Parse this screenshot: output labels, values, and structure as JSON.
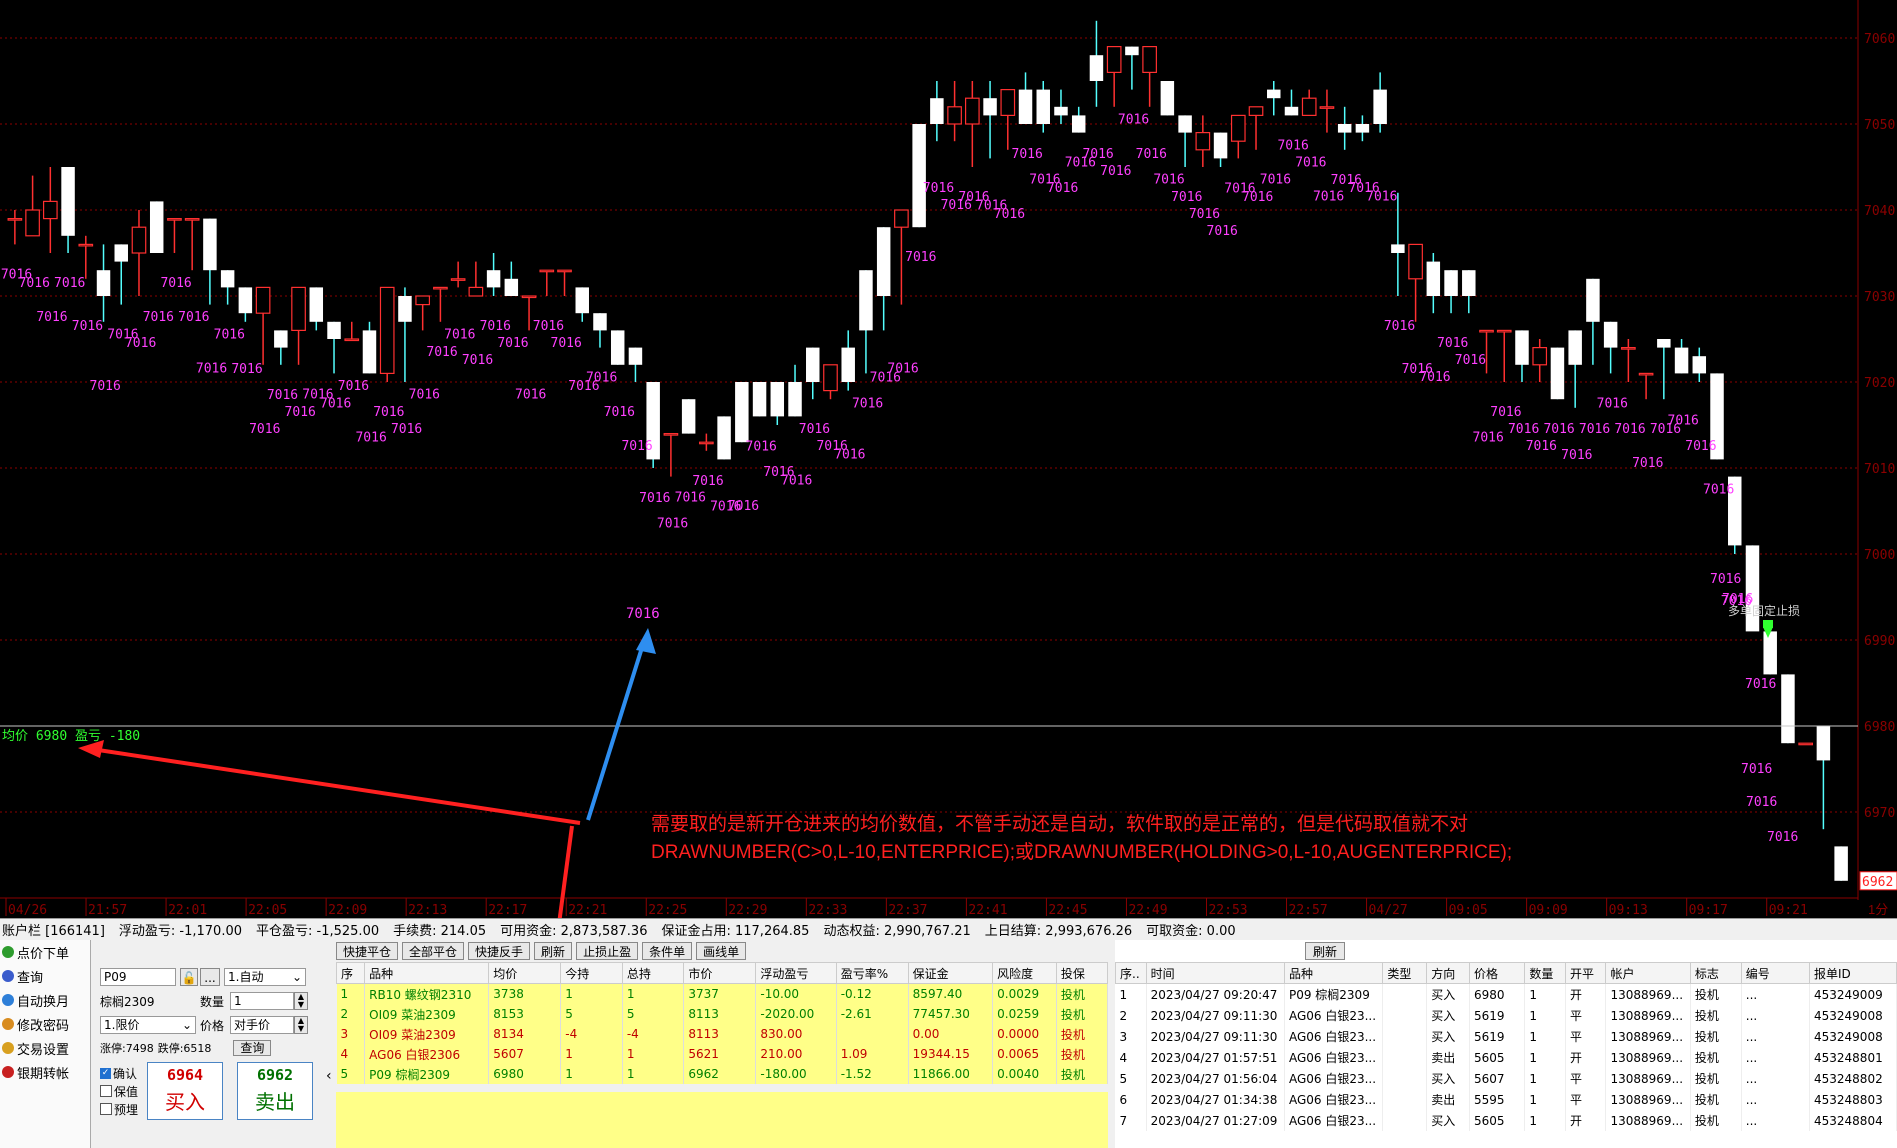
{
  "chart_data": {
    "type": "candlestick",
    "price_axis": {
      "min": 6962,
      "max": 7060,
      "ticks": [
        "7060",
        "7050",
        "7040",
        "7030",
        "7020",
        "7010",
        "7000",
        "6990",
        "6980",
        "6970"
      ],
      "current_price": "6962"
    },
    "time_axis": {
      "labels": [
        "04/26",
        "21:57",
        "22:01",
        "22:05",
        "22:09",
        "22:13",
        "22:17",
        "22:21",
        "22:25",
        "22:29",
        "22:33",
        "22:37",
        "22:41",
        "22:45",
        "22:49",
        "22:53",
        "22:57",
        "04/27",
        "09:05",
        "09:09",
        "09:13",
        "09:17",
        "09:21"
      ],
      "period": "1分"
    },
    "avg_line": {
      "label": "均价",
      "price": "6980",
      "pnl_label": "盈亏",
      "pnl": "-180"
    },
    "marker_value": "7016",
    "stop_note": "多单固定止损",
    "annotation": {
      "line1": "需要取的是新开仓进来的均价数值，不管手动还是自动，软件取的是正常的，但是代码取值就不对",
      "line2": "DRAWNUMBER(C>0,L-10,ENTERPRICE);或DRAWNUMBER(HOLDING>0,L-10,AUGENTERPRICE);"
    },
    "candles": [
      [
        7039,
        7040,
        7036,
        7039
      ],
      [
        7037,
        7044,
        7037,
        7040
      ],
      [
        7039,
        7045,
        7035,
        7041
      ],
      [
        7045,
        7045,
        7035,
        7037
      ],
      [
        7036,
        7037,
        7032,
        7036
      ],
      [
        7033,
        7036,
        7027,
        7030
      ],
      [
        7036,
        7036,
        7029,
        7034
      ],
      [
        7035,
        7040,
        7030,
        7038
      ],
      [
        7041,
        7041,
        7035,
        7035
      ],
      [
        7039,
        7039,
        7035,
        7039
      ],
      [
        7039,
        7039,
        7033,
        7039
      ],
      [
        7039,
        7039,
        7029,
        7033
      ],
      [
        7033,
        7033,
        7029,
        7031
      ],
      [
        7031,
        7031,
        7027,
        7028
      ],
      [
        7028,
        7031,
        7022,
        7031
      ],
      [
        7026,
        7026,
        7022,
        7024
      ],
      [
        7026,
        7031,
        7022,
        7031
      ],
      [
        7031,
        7031,
        7026,
        7027
      ],
      [
        7027,
        7027,
        7021,
        7025
      ],
      [
        7025,
        7027,
        7025,
        7025
      ],
      [
        7026,
        7027,
        7021,
        7021
      ],
      [
        7021,
        7031,
        7020,
        7031
      ],
      [
        7030,
        7031,
        7020,
        7027
      ],
      [
        7029,
        7029,
        7026,
        7030
      ],
      [
        7031,
        7031,
        7027,
        7031
      ],
      [
        7032,
        7034,
        7031,
        7032
      ],
      [
        7030,
        7034,
        7030,
        7031
      ],
      [
        7033,
        7035,
        7030,
        7031
      ],
      [
        7032,
        7034,
        7030,
        7030
      ],
      [
        7030,
        7030,
        7026,
        7030
      ],
      [
        7033,
        7033,
        7030,
        7033
      ],
      [
        7033,
        7033,
        7030,
        7033
      ],
      [
        7031,
        7031,
        7027,
        7028
      ],
      [
        7028,
        7028,
        7024,
        7026
      ],
      [
        7026,
        7026,
        7022,
        7022
      ],
      [
        7024,
        7024,
        7020,
        7022
      ],
      [
        7020,
        7020,
        7010,
        7011
      ],
      [
        7014,
        7014,
        7009,
        7014
      ],
      [
        7018,
        7018,
        7014,
        7014
      ],
      [
        7013,
        7014,
        7012,
        7013
      ],
      [
        7016,
        7016,
        7011,
        7011
      ],
      [
        7020,
        7020,
        7013,
        7013
      ],
      [
        7020,
        7020,
        7016,
        7016
      ],
      [
        7020,
        7020,
        7015,
        7016
      ],
      [
        7020,
        7022,
        7016,
        7016
      ],
      [
        7024,
        7024,
        7018,
        7020
      ],
      [
        7019,
        7022,
        7018,
        7022
      ],
      [
        7024,
        7026,
        7019,
        7020
      ],
      [
        7033,
        7033,
        7021,
        7026
      ],
      [
        7038,
        7038,
        7026,
        7030
      ],
      [
        7038,
        7040,
        7029,
        7040
      ],
      [
        7050,
        7050,
        7038,
        7038
      ],
      [
        7053,
        7055,
        7048,
        7050
      ],
      [
        7050,
        7055,
        7048,
        7052
      ],
      [
        7050,
        7055,
        7045,
        7053
      ],
      [
        7053,
        7055,
        7046,
        7051
      ],
      [
        7051,
        7054,
        7047,
        7054
      ],
      [
        7054,
        7056,
        7050,
        7050
      ],
      [
        7054,
        7055,
        7049,
        7050
      ],
      [
        7052,
        7054,
        7050,
        7051
      ],
      [
        7051,
        7052,
        7049,
        7049
      ],
      [
        7058,
        7062,
        7052,
        7055
      ],
      [
        7056,
        7058,
        7052,
        7059
      ],
      [
        7059,
        7059,
        7054,
        7058
      ],
      [
        7056,
        7059,
        7052,
        7059
      ],
      [
        7055,
        7055,
        7051,
        7051
      ],
      [
        7051,
        7051,
        7045,
        7049
      ],
      [
        7047,
        7051,
        7045,
        7049
      ],
      [
        7049,
        7049,
        7045,
        7046
      ],
      [
        7048,
        7051,
        7046,
        7051
      ],
      [
        7051,
        7051,
        7047,
        7052
      ],
      [
        7054,
        7055,
        7051,
        7053
      ],
      [
        7052,
        7054,
        7051,
        7051
      ],
      [
        7051,
        7054,
        7051,
        7053
      ],
      [
        7052,
        7054,
        7049,
        7052
      ],
      [
        7050,
        7052,
        7047,
        7049
      ],
      [
        7050,
        7051,
        7048,
        7049
      ],
      [
        7054,
        7056,
        7049,
        7050
      ],
      [
        7036,
        7042,
        7030,
        7035
      ],
      [
        7032,
        7036,
        7027,
        7036
      ],
      [
        7034,
        7035,
        7028,
        7030
      ],
      [
        7033,
        7033,
        7028,
        7030
      ],
      [
        7033,
        7033,
        7028,
        7030
      ],
      [
        7026,
        7026,
        7021,
        7026
      ],
      [
        7026,
        7026,
        7020,
        7026
      ],
      [
        7026,
        7026,
        7020,
        7022
      ],
      [
        7022,
        7025,
        7020,
        7024
      ],
      [
        7024,
        7024,
        7018,
        7018
      ],
      [
        7026,
        7026,
        7017,
        7022
      ],
      [
        7032,
        7032,
        7022,
        7027
      ],
      [
        7027,
        7027,
        7021,
        7024
      ],
      [
        7024,
        7025,
        7020,
        7024
      ],
      [
        7021,
        7021,
        7018,
        7021
      ],
      [
        7025,
        7025,
        7018,
        7024
      ],
      [
        7024,
        7025,
        7021,
        7021
      ],
      [
        7023,
        7024,
        7020,
        7021
      ],
      [
        7021,
        7021,
        7011,
        7011
      ],
      [
        7009,
        7009,
        7000,
        7001
      ],
      [
        7001,
        7001,
        6992,
        6991
      ],
      [
        6991,
        6991,
        6986,
        6986
      ],
      [
        6986,
        6986,
        6978,
        6978
      ],
      [
        6978,
        6978,
        6978,
        6978
      ],
      [
        6980,
        6980,
        6968,
        6976
      ],
      [
        6966,
        6966,
        6962,
        6962
      ]
    ]
  },
  "account_bar": {
    "account": "账户栏 [166141]",
    "float_pnl": "浮动盈亏: -1,170.00",
    "close_pnl": "平仓盈亏: -1,525.00",
    "fee": "手续费: 214.05",
    "available": "可用资金: 2,873,587.36",
    "margin": "保证金占用: 117,264.85",
    "equity": "动态权益: 2,990,767.21",
    "prev_settle": "上日结算: 2,993,676.26",
    "withdrawable": "可取资金: 0.00"
  },
  "left_nav": [
    {
      "label": "点价下单",
      "icon": "green-tick-icon",
      "color": "#2e9c2e"
    },
    {
      "label": "查询",
      "icon": "list-icon",
      "color": "#3a5ccc"
    },
    {
      "label": "自动换月",
      "icon": "cycle-icon",
      "color": "#2e7fd8"
    },
    {
      "label": "修改密码",
      "icon": "key-icon",
      "color": "#d88c20"
    },
    {
      "label": "交易设置",
      "icon": "gear-icon",
      "color": "#d8a020"
    },
    {
      "label": "银期转帐",
      "icon": "bank-icon",
      "color": "#c82020"
    }
  ],
  "order_panel": {
    "contract": "P09",
    "mode": "1.自动",
    "contract_name": "棕榈2309",
    "qty_label": "数量",
    "qty": "1",
    "order_type": "1.限价",
    "price_label": "价格",
    "price_mode": "对手价",
    "limit_up": "涨停:7498",
    "limit_down": "跌停:6518",
    "query_btn": "查询",
    "confirm": "确认",
    "hedge": "保值",
    "preorder": "预埋",
    "buy_price": "6964",
    "buy_label": "买入",
    "sell_price": "6962",
    "sell_label": "卖出",
    "dots": "..."
  },
  "pos_toolbar": [
    "快捷平仓",
    "全部平仓",
    "快捷反手",
    "刷新",
    "止损止盈",
    "条件单",
    "画线单"
  ],
  "positions": {
    "headers": [
      "序",
      "品种",
      "均价",
      "今持",
      "总持",
      "市价",
      "浮动盈亏",
      "盈亏率%",
      "保证金",
      "风险度",
      "投保"
    ],
    "rows": [
      [
        "1",
        "RB10 螺纹钢2310",
        "3738",
        "1",
        "1",
        "3737",
        "-10.00",
        "-0.12",
        "8597.40",
        "0.0029",
        "投机"
      ],
      [
        "2",
        "OI09 菜油2309",
        "8153",
        "5",
        "5",
        "8113",
        "-2020.00",
        "-2.61",
        "77457.30",
        "0.0259",
        "投机"
      ],
      [
        "3",
        "OI09 菜油2309",
        "8134",
        "-4",
        "-4",
        "8113",
        "830.00",
        "",
        "0.00",
        "0.0000",
        "投机"
      ],
      [
        "4",
        "AG06 白银2306",
        "5607",
        "1",
        "1",
        "5621",
        "210.00",
        "1.09",
        "19344.15",
        "0.0065",
        "投机"
      ],
      [
        "5",
        "P09 棕榈2309",
        "6980",
        "1",
        "1",
        "6962",
        "-180.00",
        "-1.52",
        "11866.00",
        "0.0040",
        "投机"
      ]
    ],
    "row_colors": [
      "green",
      "green",
      "red",
      "red",
      "green"
    ]
  },
  "fills": {
    "refresh": "刷新",
    "headers": [
      "序..",
      "时间",
      "品种",
      "类型",
      "方向",
      "价格",
      "数量",
      "开平",
      "帐户",
      "标志",
      "编号",
      "报单ID"
    ],
    "rows": [
      [
        "1",
        "2023/04/27 09:20:47",
        "P09 棕榈2309",
        "",
        "买入",
        "6980",
        "1",
        "开",
        "13088969...",
        "投机",
        "...",
        "453249009"
      ],
      [
        "2",
        "2023/04/27 09:11:30",
        "AG06 白银23...",
        "",
        "买入",
        "5619",
        "1",
        "平",
        "13088969...",
        "投机",
        "...",
        "453249008"
      ],
      [
        "3",
        "2023/04/27 09:11:30",
        "AG06 白银23...",
        "",
        "买入",
        "5619",
        "1",
        "平",
        "13088969...",
        "投机",
        "...",
        "453249008"
      ],
      [
        "4",
        "2023/04/27 01:57:51",
        "AG06 白银23...",
        "",
        "卖出",
        "5605",
        "1",
        "开",
        "13088969...",
        "投机",
        "...",
        "453248801"
      ],
      [
        "5",
        "2023/04/27 01:56:04",
        "AG06 白银23...",
        "",
        "买入",
        "5607",
        "1",
        "平",
        "13088969...",
        "投机",
        "...",
        "453248802"
      ],
      [
        "6",
        "2023/04/27 01:34:38",
        "AG06 白银23...",
        "",
        "卖出",
        "5595",
        "1",
        "平",
        "13088969...",
        "投机",
        "...",
        "453248803"
      ],
      [
        "7",
        "2023/04/27 01:27:09",
        "AG06 白银23...",
        "",
        "买入",
        "5605",
        "1",
        "开",
        "13088969...",
        "投机",
        "...",
        "453248804"
      ]
    ]
  },
  "colors": {
    "up": "#ff3030",
    "down": "#54ffff",
    "marker": "#ff40ff",
    "grid": "#8b0000",
    "annotation": "#ff2020",
    "avg": "#30ff30"
  }
}
